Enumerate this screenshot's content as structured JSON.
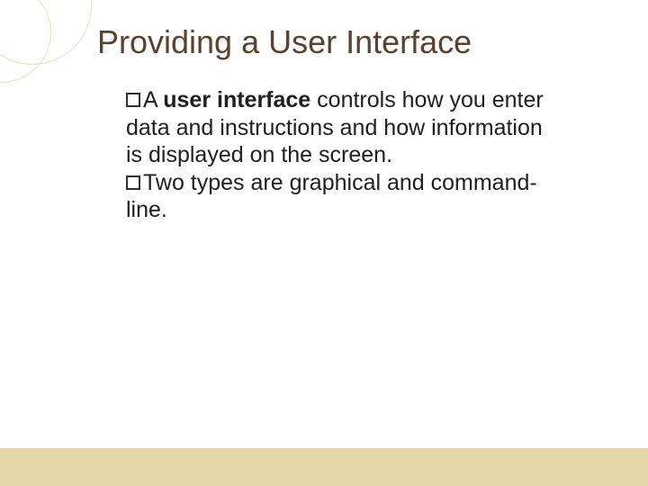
{
  "title": "Providing a User Interface",
  "bullets": [
    {
      "lead": "A ",
      "bold": "user interface",
      "rest": " controls how you enter data and instructions and how information is displayed on the screen."
    },
    {
      "lead": "Two types are graphical and command-line.",
      "bold": "",
      "rest": ""
    }
  ]
}
